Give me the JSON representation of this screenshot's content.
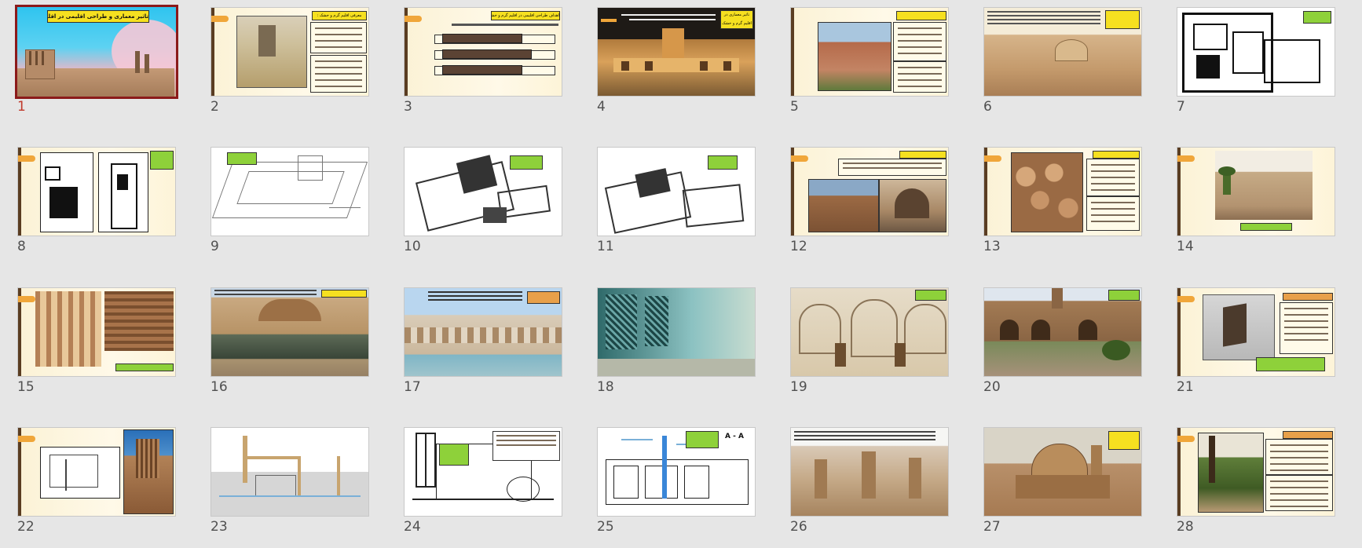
{
  "slides": [
    {
      "number": "1",
      "selected": true
    },
    {
      "number": "2"
    },
    {
      "number": "3"
    },
    {
      "number": "4"
    },
    {
      "number": "5"
    },
    {
      "number": "6"
    },
    {
      "number": "7"
    },
    {
      "number": "8"
    },
    {
      "number": "9"
    },
    {
      "number": "10"
    },
    {
      "number": "11"
    },
    {
      "number": "12"
    },
    {
      "number": "13"
    },
    {
      "number": "14"
    },
    {
      "number": "15"
    },
    {
      "number": "16"
    },
    {
      "number": "17"
    },
    {
      "number": "18"
    },
    {
      "number": "19"
    },
    {
      "number": "20"
    },
    {
      "number": "21"
    },
    {
      "number": "22"
    },
    {
      "number": "23"
    },
    {
      "number": "24"
    },
    {
      "number": "25"
    },
    {
      "number": "26"
    },
    {
      "number": "27"
    },
    {
      "number": "28"
    }
  ],
  "slide1": {
    "title": "تاثیر معماری و طراحی اقلیمی در اقلیم گرم و خشک"
  },
  "slide2": {
    "heading": "معرفی اقلیم گرم و خشک :"
  },
  "slide3": {
    "heading": "اهداف طراحی اقلیمی در اقلیم گرم و خشک :"
  },
  "slide4": {
    "heading": "تاثیر معماری در اقلیم گرم و خشک :"
  },
  "slide25": {
    "section_label": "A - A"
  },
  "colors": {
    "selected_border": "#8b1a1a",
    "background": "#e6e6e6",
    "accent_orange": "#f0a63a",
    "yellow_label": "#f6e020",
    "green_label": "#8ed13a"
  }
}
